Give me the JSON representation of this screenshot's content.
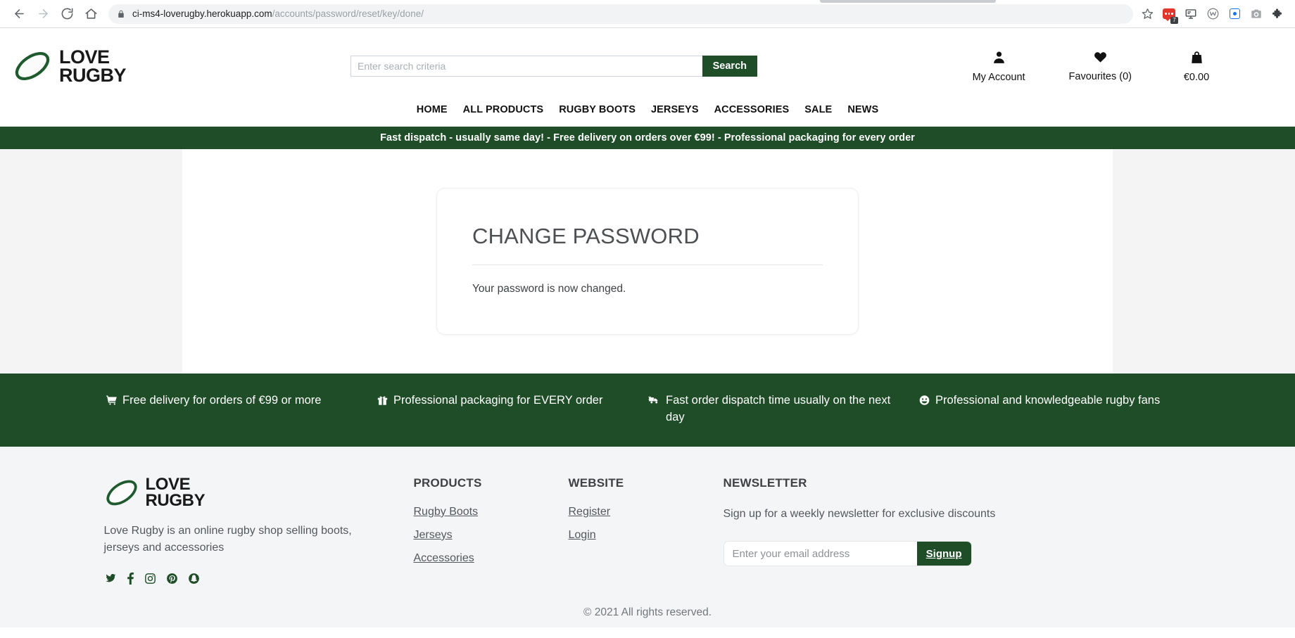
{
  "browser": {
    "back_icon": "back-arrow-icon",
    "forward_icon": "forward-arrow-icon",
    "reload_icon": "reload-icon",
    "home_icon": "home-icon",
    "lock_icon": "lock-icon",
    "url_domain": "ci-ms4-loverugby.herokuapp.com",
    "url_path": "/accounts/password/reset/key/done/",
    "bookmark_icon": "star-icon",
    "extensions": [
      {
        "name": "speech-bubble-extension-icon",
        "badge": "7"
      },
      {
        "name": "monitor-extension-icon"
      },
      {
        "name": "w-circle-extension-icon"
      },
      {
        "name": "blue-square-extension-icon"
      },
      {
        "name": "camera-extension-icon"
      },
      {
        "name": "puzzle-extensions-icon"
      }
    ]
  },
  "colors": {
    "brand_green": "#1e4d28",
    "page_bg": "#f4f4f4",
    "text_dark": "#111111",
    "muted": "#54585c"
  },
  "header": {
    "logo_line1": "LOVE",
    "logo_line2": "RUGBY",
    "search": {
      "placeholder": "Enter search criteria",
      "value": "",
      "button_label": "Search"
    },
    "actions": [
      {
        "icon": "user-icon",
        "label": "My Account"
      },
      {
        "icon": "heart-icon",
        "label": "Favourites (0)"
      },
      {
        "icon": "shopping-bag-icon",
        "label": "€0.00"
      }
    ],
    "nav": [
      {
        "label": "HOME"
      },
      {
        "label": "ALL PRODUCTS"
      },
      {
        "label": "RUGBY BOOTS"
      },
      {
        "label": "JERSEYS"
      },
      {
        "label": "ACCESSORIES"
      },
      {
        "label": "SALE"
      },
      {
        "label": "NEWS"
      }
    ],
    "promo_banner": "Fast dispatch - usually same day! - Free delivery on orders over €99! - Professional packaging for every order"
  },
  "main": {
    "card_title": "CHANGE PASSWORD",
    "card_message": "Your password is now changed."
  },
  "features": [
    {
      "icon": "shopping-cart-icon",
      "text": "Free delivery for orders of €99 or more"
    },
    {
      "icon": "gift-icon",
      "text": "Professional packaging for EVERY order"
    },
    {
      "icon": "delivery-truck-icon",
      "text": "Fast order dispatch time usually on the next day"
    },
    {
      "icon": "smiley-face-icon",
      "text": "Professional and knowledgeable rugby fans"
    }
  ],
  "footer": {
    "logo_line1": "LOVE",
    "logo_line2": "RUGBY",
    "description": "Love Rugby is an online rugby shop selling boots, jerseys and accessories",
    "socials": [
      {
        "icon": "twitter-icon"
      },
      {
        "icon": "facebook-icon"
      },
      {
        "icon": "instagram-icon"
      },
      {
        "icon": "pinterest-icon"
      },
      {
        "icon": "snapchat-icon"
      }
    ],
    "products": {
      "heading": "PRODUCTS",
      "links": [
        {
          "label": "Rugby Boots"
        },
        {
          "label": "Jerseys"
        },
        {
          "label": "Accessories"
        }
      ]
    },
    "website": {
      "heading": "WEBSITE",
      "links": [
        {
          "label": "Register"
        },
        {
          "label": "Login"
        }
      ]
    },
    "newsletter": {
      "heading": "NEWSLETTER",
      "text": "Sign up for a weekly newsletter for exclusive discounts",
      "placeholder": "Enter your email address",
      "value": "",
      "button_label": "Signup"
    },
    "copyright": "© 2021 All rights reserved."
  }
}
